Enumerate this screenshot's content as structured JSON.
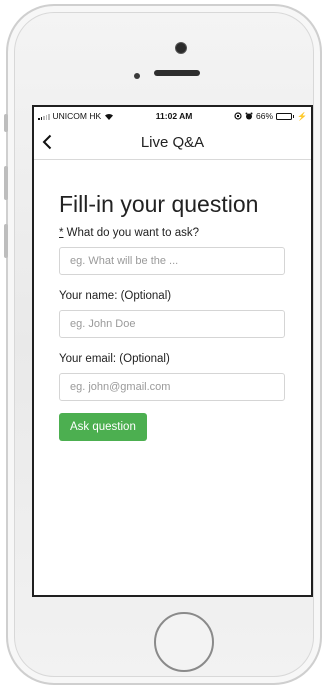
{
  "status_bar": {
    "carrier": "UNICOM HK",
    "time": "11:02 AM",
    "battery": "66%",
    "battery_level": 0.66
  },
  "nav": {
    "title": "Live Q&A",
    "back_icon": "chevron-left-icon"
  },
  "form": {
    "title": "Fill-in your question",
    "question": {
      "required_marker": "*",
      "label": " What do you want to ask?",
      "placeholder": "eg. What will be the ..."
    },
    "name": {
      "label": "Your name: (Optional)",
      "placeholder": "eg. John Doe"
    },
    "email": {
      "label": "Your email: (Optional)",
      "placeholder": "eg. john@gmail.com"
    },
    "submit_label": "Ask question"
  },
  "colors": {
    "accent": "#4caf50",
    "battery_fill": "#4cd964"
  }
}
